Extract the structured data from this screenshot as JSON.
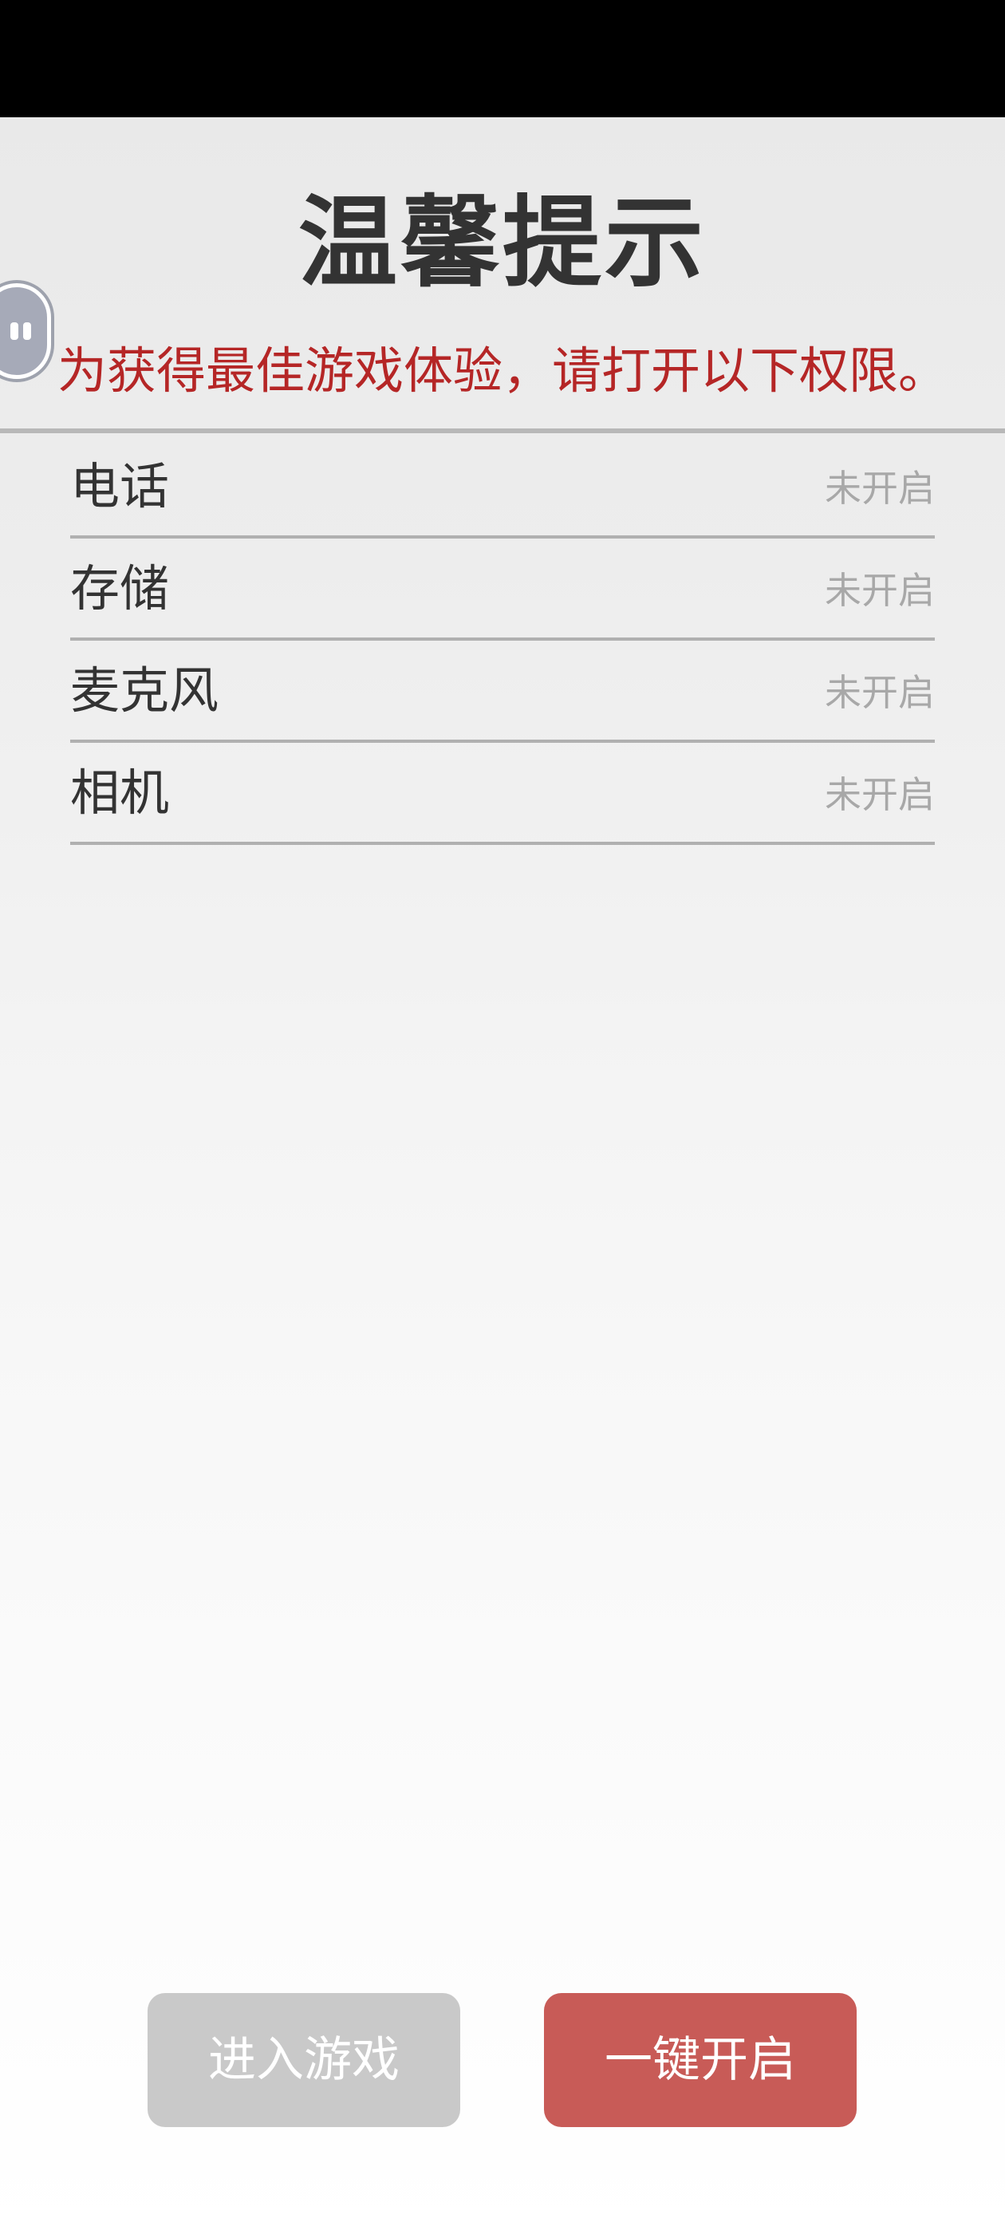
{
  "dialog": {
    "title": "温馨提示",
    "subtitle": "为获得最佳游戏体验，请打开以下权限。"
  },
  "permissions": [
    {
      "name": "电话",
      "status": "未开启"
    },
    {
      "name": "存储",
      "status": "未开启"
    },
    {
      "name": "麦克风",
      "status": "未开启"
    },
    {
      "name": "相机",
      "status": "未开启"
    }
  ],
  "buttons": {
    "enter_game": "进入游戏",
    "enable_all": "一键开启"
  },
  "colors": {
    "subtitle": "#b52626",
    "enable_button": "#c85b57",
    "enter_button": "#c9c9c9"
  },
  "icons": {
    "floating_ball": "assistant-floating-ball-icon"
  }
}
